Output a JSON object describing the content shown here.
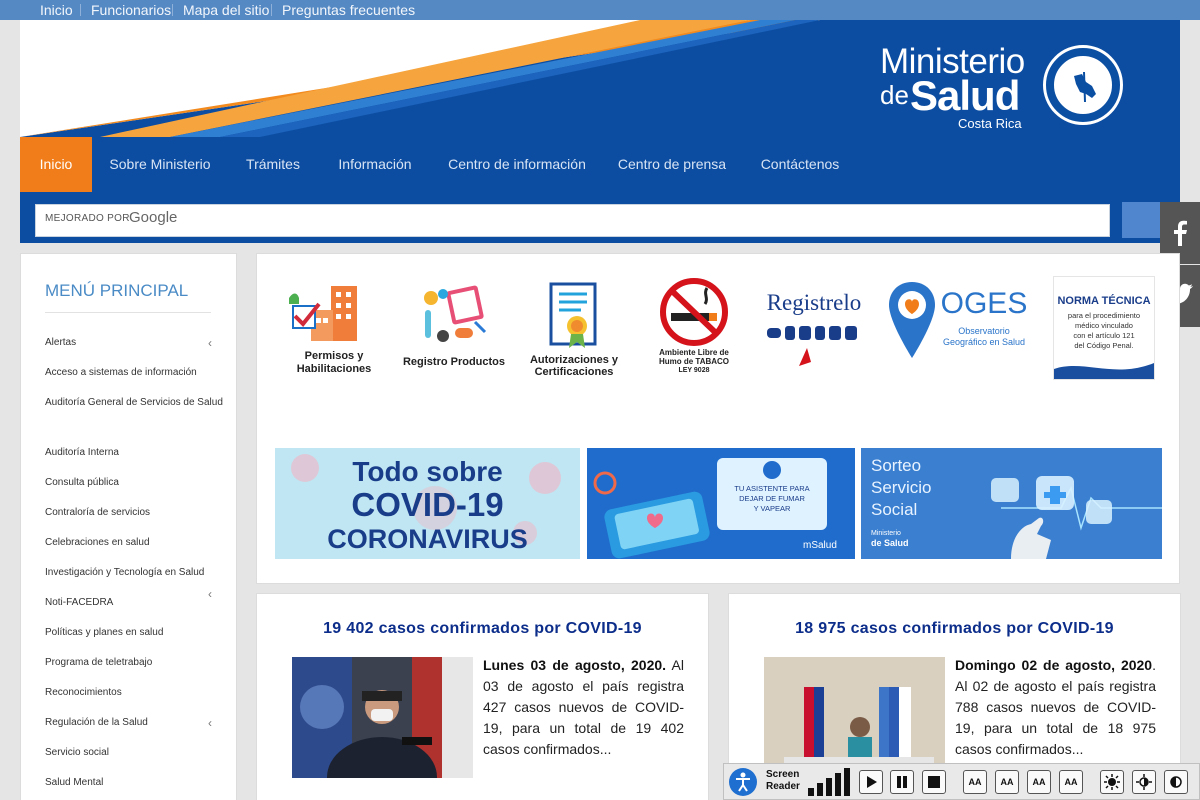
{
  "topbar": {
    "links": [
      "Inicio",
      "Funcionarios",
      "Mapa del sitio",
      "Preguntas frecuentes"
    ]
  },
  "header": {
    "logo_line1": "Ministerio",
    "logo_de": "de",
    "logo_salud": "Salud",
    "logo_country": "Costa Rica",
    "seal_name": "costa-rica-seal"
  },
  "nav": {
    "items": [
      "Inicio",
      "Sobre Ministerio",
      "Trámites",
      "Información",
      "Centro de información",
      "Centro de prensa",
      "Contáctenos"
    ],
    "active_index": 0
  },
  "search": {
    "powered_by": "MEJORADO POR",
    "brand": "Google",
    "placeholder": ""
  },
  "social": {
    "facebook_icon": "facebook-icon",
    "twitter_icon": "twitter-icon"
  },
  "sidebar": {
    "title": "MENÚ PRINCIPAL",
    "items": [
      {
        "label": "Alertas",
        "has_submenu": true
      },
      {
        "label": "Acceso a sistemas de información",
        "has_submenu": false
      },
      {
        "label": "Auditoría General de Servicios de Salud",
        "has_submenu": false
      },
      {
        "label": "Auditoría Interna",
        "has_submenu": false
      },
      {
        "label": "Consulta pública",
        "has_submenu": false
      },
      {
        "label": "Contraloría de servicios",
        "has_submenu": false
      },
      {
        "label": "Celebraciones en salud",
        "has_submenu": false
      },
      {
        "label": "Investigación y Tecnología en Salud",
        "has_submenu": false
      },
      {
        "label": "Noti-FACEDRA",
        "has_submenu": true
      },
      {
        "label": "Políticas y planes en salud",
        "has_submenu": false
      },
      {
        "label": "Programa de teletrabajo",
        "has_submenu": false
      },
      {
        "label": "Reconocimientos",
        "has_submenu": false
      },
      {
        "label": "Regulación de la Salud",
        "has_submenu": true
      },
      {
        "label": "Servicio social",
        "has_submenu": false
      },
      {
        "label": "Salud Mental",
        "has_submenu": false
      }
    ]
  },
  "quick_links": [
    {
      "label_1": "Permisos y",
      "label_2": "Habilitaciones"
    },
    {
      "label_1": "Registro Productos",
      "label_2": ""
    },
    {
      "label_1": "Autorizaciones y",
      "label_2": "Certificaciones"
    },
    {
      "label_1": "Ambiente Libre de",
      "label_2": "Humo de TABACO",
      "label_3": "LEY 9028"
    },
    {
      "label_1": "Registrelo",
      "label_2": ""
    },
    {
      "label_1": "OGES",
      "label_2": "Observatorio",
      "label_3": "Geográfico en Salud"
    },
    {
      "label_1": "NORMA TÉCNICA",
      "label_2": "para el procedimiento",
      "label_3": "médico vinculado",
      "label_4": "con el artículo 121",
      "label_5": "del Código Penal."
    }
  ],
  "banners": [
    {
      "line1": "Todo sobre",
      "line2": "COVID-19",
      "line3": "CORONAVIRUS"
    },
    {
      "line1": "TU ASISTENTE PARA",
      "line2": "DEJAR DE FUMAR",
      "line3": "Y VAPEAR",
      "brand": "mSalud"
    },
    {
      "line1": "Sorteo",
      "line2": "Servicio",
      "line3": "Social",
      "brand_1": "Ministerio",
      "brand_2": "de Salud"
    }
  ],
  "news": [
    {
      "title": "19 402 casos confirmados por COVID-19",
      "date": "Lunes 03 de agosto, 2020.",
      "body": " Al 03 de agosto el país registra 427 casos nuevos de COVID-19, para un total de 19 402 casos confirmados..."
    },
    {
      "title": "18 975 casos confirmados por COVID-19",
      "date": "Domingo 02 de agosto, 2020",
      "body": ". Al 02 de agosto el país registra 788 casos nuevos de COVID-19, para un total de 18 975 casos confirmados..."
    }
  ],
  "reader": {
    "label_1": "Screen",
    "label_2": "Reader",
    "buttons": [
      "AA",
      "AA",
      "AA",
      "AA"
    ]
  },
  "colors": {
    "nav_blue": "#0c4da2",
    "accent_orange": "#f07d1a",
    "topbar_blue": "#5589c4",
    "menu_title": "#4a8bc6",
    "news_title": "#0c2d8a"
  }
}
